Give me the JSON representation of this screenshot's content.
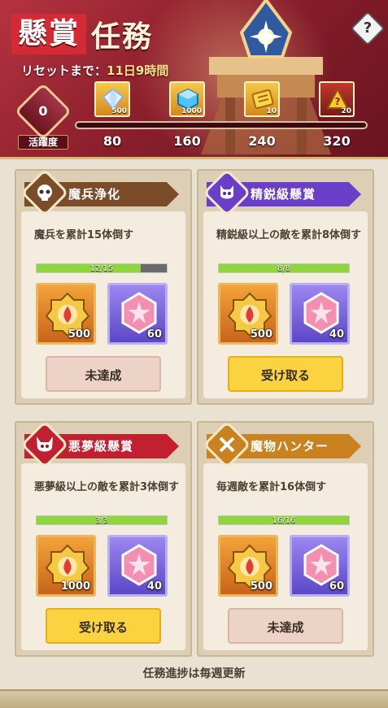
{
  "header": {
    "title_a": "懸賞",
    "title_b": "任務",
    "reset_label": "リセットまで：",
    "reset_value": "11日9時間",
    "help_symbol": "?",
    "activity_value": "0",
    "activity_label": "活躍度",
    "milestones": [
      {
        "value": "80",
        "qty": "500",
        "icon": "diamond-icon"
      },
      {
        "value": "160",
        "qty": "1000",
        "icon": "crystal-cube-icon"
      },
      {
        "value": "240",
        "qty": "10",
        "icon": "ticket-icon"
      },
      {
        "value": "320",
        "qty": "20",
        "icon": "mystery-chest-icon"
      }
    ]
  },
  "missions": [
    {
      "title": "魔兵浄化",
      "desc": "魔兵を累計15体倒す",
      "progress_text": "12/15",
      "progress": 0.8,
      "rewards": [
        {
          "qty": "500",
          "type": "gold"
        },
        {
          "qty": "60",
          "type": "purple"
        }
      ],
      "action": "未達成",
      "state": "pending",
      "color": "#7a4c28"
    },
    {
      "title": "精鋭級懸賞",
      "desc": "精鋭級以上の敵を累計8体倒す",
      "progress_text": "8/8",
      "progress": 1.0,
      "rewards": [
        {
          "qty": "500",
          "type": "gold"
        },
        {
          "qty": "40",
          "type": "purple"
        }
      ],
      "action": "受け取る",
      "state": "claim",
      "color": "#6a3ec8"
    },
    {
      "title": "悪夢級懸賞",
      "desc": "悪夢級以上の敵を累計3体倒す",
      "progress_text": "3/3",
      "progress": 1.0,
      "rewards": [
        {
          "qty": "1000",
          "type": "gold"
        },
        {
          "qty": "40",
          "type": "purple"
        }
      ],
      "action": "受け取る",
      "state": "claim",
      "color": "#c22030"
    },
    {
      "title": "魔物ハンター",
      "desc": "毎週敵を累計16体倒す",
      "progress_text": "16/16",
      "progress": 1.0,
      "rewards": [
        {
          "qty": "500",
          "type": "gold"
        },
        {
          "qty": "60",
          "type": "purple"
        }
      ],
      "action": "未達成",
      "state": "pending",
      "color": "#c9821f"
    }
  ],
  "footer": "任務進捗は毎週更新"
}
